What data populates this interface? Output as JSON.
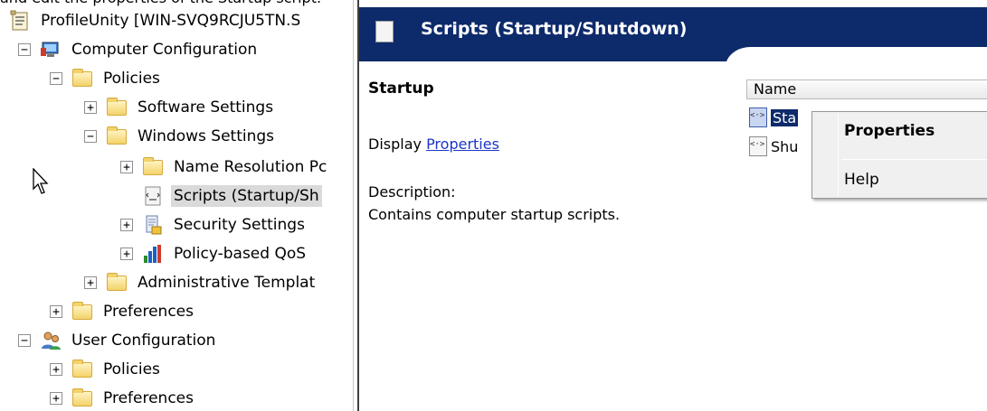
{
  "caption": "and edit the properties of the Startup script.",
  "tree": {
    "items": [
      {
        "label": "ProfileUnity [WIN-SVQ9RCJU5TN.S",
        "expander": "",
        "icon": "gpo-document-icon"
      },
      {
        "label": "Computer Configuration",
        "expander": "−",
        "icon": "computer-icon"
      },
      {
        "label": "Policies",
        "expander": "−",
        "icon": "folder-icon"
      },
      {
        "label": "Software Settings",
        "expander": "+",
        "icon": "folder-icon"
      },
      {
        "label": "Windows Settings",
        "expander": "−",
        "icon": "folder-icon"
      },
      {
        "label": "Name Resolution Pc",
        "expander": "+",
        "icon": "folder-icon"
      },
      {
        "label": "Scripts (Startup/Sh",
        "expander": "",
        "icon": "script-icon"
      },
      {
        "label": "Security Settings",
        "expander": "+",
        "icon": "security-icon"
      },
      {
        "label": "Policy-based QoS",
        "expander": "+",
        "icon": "bar-chart-icon"
      },
      {
        "label": "Administrative Templat",
        "expander": "+",
        "icon": "folder-icon"
      },
      {
        "label": "Preferences",
        "expander": "+",
        "icon": "folder-icon"
      },
      {
        "label": "User Configuration",
        "expander": "−",
        "icon": "users-icon"
      },
      {
        "label": "Policies",
        "expander": "+",
        "icon": "folder-icon"
      },
      {
        "label": "Preferences",
        "expander": "+",
        "icon": "folder-icon"
      }
    ]
  },
  "banner": {
    "title": "Scripts (Startup/Shutdown)"
  },
  "details": {
    "heading": "Startup",
    "display_prefix": "Display ",
    "display_link": "Properties",
    "description_label": "Description:",
    "description_text": "Contains computer startup scripts."
  },
  "list": {
    "column_header": "Name",
    "items": [
      {
        "label": "Sta"
      },
      {
        "label": "Shu"
      }
    ]
  },
  "context_menu": {
    "properties": "Properties",
    "help": "Help"
  },
  "colors": {
    "banner": "#0d2a6b",
    "selection": "#0d2a6b",
    "link": "#1c35c9"
  }
}
